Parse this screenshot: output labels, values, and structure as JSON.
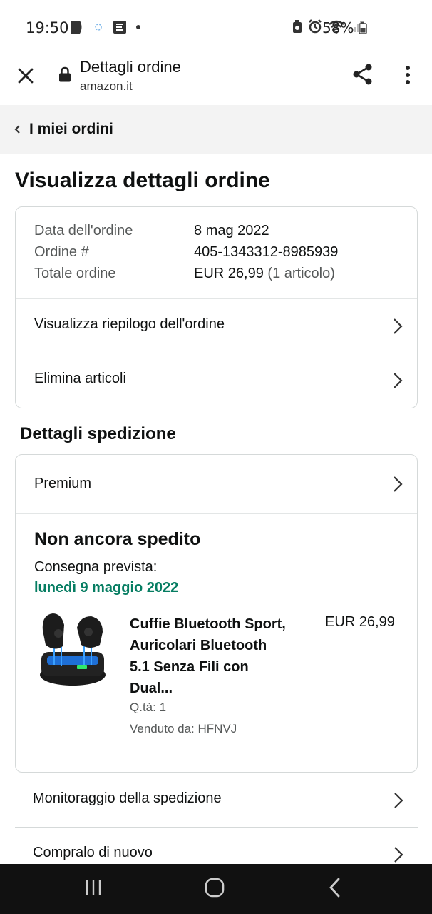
{
  "status_bar": {
    "time": "19:50",
    "battery": "58%",
    "left_icons": [
      "media-play-icon",
      "cloud-icon",
      "news-icon",
      "dot-icon"
    ],
    "right_icons": [
      "battery-saver-icon",
      "alarm-icon",
      "wifi-icon",
      "signal-icon"
    ]
  },
  "browser": {
    "title": "Dettagli ordine",
    "domain": "amazon.it"
  },
  "nav": {
    "back_label": "I miei ordini"
  },
  "page": {
    "title": "Visualizza dettagli ordine"
  },
  "order": {
    "date_label": "Data dell'ordine",
    "date_value": "8 mag 2022",
    "number_label": "Ordine #",
    "number_value": "405-1343312-8985939",
    "total_label": "Totale ordine",
    "total_value": "EUR 26,99",
    "total_items": "(1 articolo)",
    "summary_link": "Visualizza riepilogo dell'ordine",
    "delete_link": "Elimina articoli"
  },
  "shipping": {
    "section_title": "Dettagli spedizione",
    "method": "Premium",
    "status": "Non ancora spedito",
    "delivery_label": "Consegna prevista:",
    "delivery_date": "lunedì 9 maggio 2022"
  },
  "product": {
    "title_lines": [
      "Cuffie Bluetooth Sport,",
      "Auricolari Bluetooth",
      "5.1 Senza Fili con",
      "Dual..."
    ],
    "price": "EUR 26,99",
    "quantity": "Q.tà: 1",
    "seller": "Venduto da: HFNVJ"
  },
  "actions": {
    "tracking": "Monitoraggio della spedizione",
    "buy_again": "Compralo di nuovo"
  },
  "colors": {
    "delivery_green": "#067d62",
    "navbar": "#111111",
    "backnav_bg": "#f3f3f3"
  }
}
